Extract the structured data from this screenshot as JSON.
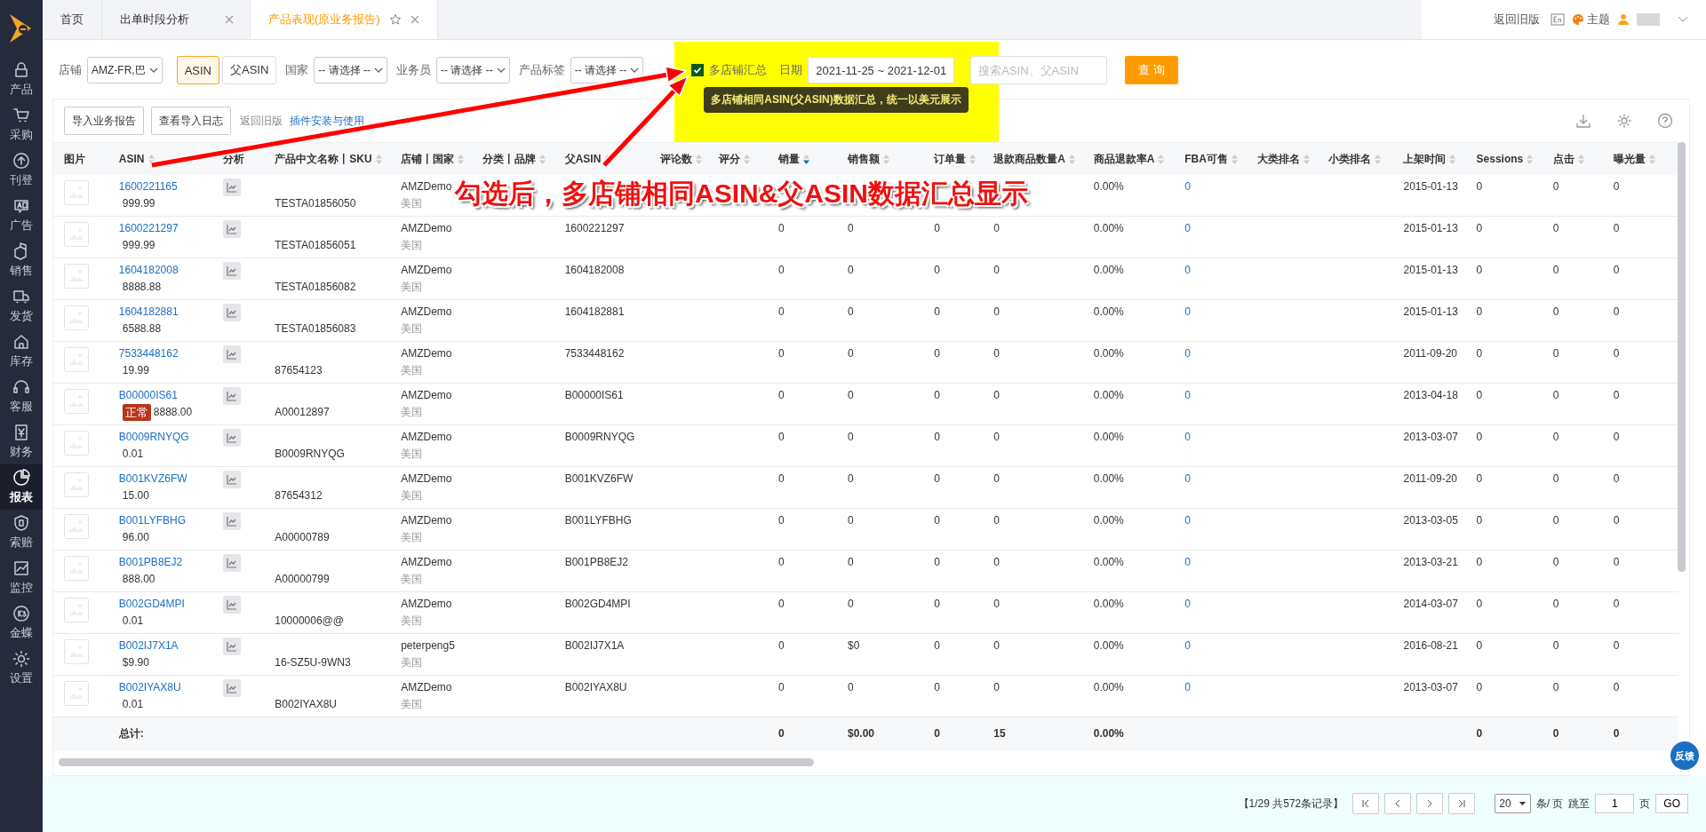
{
  "sidebar": {
    "items": [
      {
        "label": "产品",
        "selected": false
      },
      {
        "label": "采购",
        "selected": false
      },
      {
        "label": "刊登",
        "selected": false
      },
      {
        "label": "广告",
        "selected": false
      },
      {
        "label": "销售",
        "selected": false
      },
      {
        "label": "发货",
        "selected": false
      },
      {
        "label": "库存",
        "selected": false
      },
      {
        "label": "客服",
        "selected": false
      },
      {
        "label": "财务",
        "selected": false
      },
      {
        "label": "报表",
        "selected": true
      },
      {
        "label": "索赔",
        "selected": false
      },
      {
        "label": "监控",
        "selected": false
      },
      {
        "label": "金蝶",
        "selected": false
      },
      {
        "label": "设置",
        "selected": false
      }
    ]
  },
  "tabs": [
    {
      "label": "首页",
      "selected": false,
      "closable": false,
      "starred": false
    },
    {
      "label": "出单时段分析",
      "selected": false,
      "closable": true,
      "starred": false
    },
    {
      "label": "产品表现(原业务报告)",
      "selected": true,
      "closable": true,
      "starred": true
    }
  ],
  "header": {
    "back_link": "返回旧版",
    "theme": "主题"
  },
  "filters": {
    "store_label": "店铺",
    "store_value": "AMZ-FR,巴",
    "mode_toggle": [
      {
        "label": "ASIN",
        "selected": true
      },
      {
        "label": "父ASIN",
        "selected": false
      }
    ],
    "country_label": "国家",
    "country_value": "-- 请选择 --",
    "salesperson_label": "业务员",
    "salesperson_value": "-- 请选择 --",
    "tag_label": "产品标签",
    "tag_value": "-- 请选择 --",
    "multi_store": {
      "label": "多店铺汇总",
      "checked": true
    },
    "date_label": "日期",
    "date_value": "2021-11-25 ~ 2021-12-01",
    "search_placeholder": "搜索ASIN、父ASIN",
    "query_button": "查 询",
    "tooltip": "多店铺相同ASIN(父ASIN)数据汇总，统一以美元展示"
  },
  "annotation": "勾选后，多店铺相同ASIN&父ASIN数据汇总显示",
  "toolbar": {
    "buttons": [
      "导入业务报告",
      "查看导入日志"
    ],
    "back_link": "返回旧版",
    "help_link": "插件安装与使用"
  },
  "table": {
    "columns": [
      {
        "label": "图片",
        "sortable": false
      },
      {
        "label": "ASIN",
        "sortable": true,
        "sorted_desc": false
      },
      {
        "label": "分析",
        "sortable": false
      },
      {
        "label": "产品中文名称丨SKU",
        "sortable": true,
        "sorted_desc": false
      },
      {
        "label": "店铺丨国家",
        "sortable": true,
        "sorted_desc": false
      },
      {
        "label": "分类丨品牌",
        "sortable": true,
        "sorted_desc": false
      },
      {
        "label": "父ASIN",
        "sortable": true,
        "sorted_desc": false
      },
      {
        "label": "评论数",
        "sortable": true,
        "sorted_desc": false
      },
      {
        "label": "评分",
        "sortable": true,
        "sorted_desc": false
      },
      {
        "label": "销量",
        "sortable": true,
        "sorted_desc": true
      },
      {
        "label": "销售额",
        "sortable": true,
        "sorted_desc": false
      },
      {
        "label": "订单量",
        "sortable": true,
        "sorted_desc": false
      },
      {
        "label": "退款商品数量A",
        "sortable": true,
        "sorted_desc": false
      },
      {
        "label": "商品退款率A",
        "sortable": true,
        "sorted_desc": false
      },
      {
        "label": "FBA可售",
        "sortable": true,
        "sorted_desc": false
      },
      {
        "label": "大类排名",
        "sortable": true,
        "sorted_desc": false
      },
      {
        "label": "小类排名",
        "sortable": true,
        "sorted_desc": false
      },
      {
        "label": "上架时间",
        "sortable": true,
        "sorted_desc": false
      },
      {
        "label": "Sessions",
        "sortable": true,
        "sorted_desc": false
      },
      {
        "label": "点击",
        "sortable": true,
        "sorted_desc": false
      },
      {
        "label": "曝光量",
        "sortable": true,
        "sorted_desc": false
      }
    ],
    "rows": [
      {
        "asin": "1600221165",
        "price": "999.99",
        "sku": "TESTA01856050",
        "store": "AMZDemo",
        "country": "美国",
        "refund_rate": "0.00%",
        "fba": "0",
        "listed": "2015-01-13",
        "sessions": "0",
        "clicks": "0",
        "impressions": "0"
      },
      {
        "asin": "1600221297",
        "price": "999.99",
        "sku": "TESTA01856051",
        "store": "AMZDemo",
        "country": "美国",
        "parent": "1600221297",
        "qty": "0",
        "amount": "0",
        "orders": "0",
        "refund_qty": "0",
        "refund_rate": "0.00%",
        "fba": "0",
        "listed": "2015-01-13",
        "sessions": "0",
        "clicks": "0",
        "impressions": "0"
      },
      {
        "asin": "1604182008",
        "price": "8888.88",
        "sku": "TESTA01856082",
        "store": "AMZDemo",
        "country": "美国",
        "parent": "1604182008",
        "qty": "0",
        "amount": "0",
        "orders": "0",
        "refund_qty": "0",
        "refund_rate": "0.00%",
        "fba": "0",
        "listed": "2015-01-13",
        "sessions": "0",
        "clicks": "0",
        "impressions": "0"
      },
      {
        "asin": "1604182881",
        "price": "6588.88",
        "sku": "TESTA01856083",
        "store": "AMZDemo",
        "country": "美国",
        "parent": "1604182881",
        "qty": "0",
        "amount": "0",
        "orders": "0",
        "refund_qty": "0",
        "refund_rate": "0.00%",
        "fba": "0",
        "listed": "2015-01-13",
        "sessions": "0",
        "clicks": "0",
        "impressions": "0"
      },
      {
        "asin": "7533448162",
        "price": "19.99",
        "sku": "87654123",
        "store": "AMZDemo",
        "country": "美国",
        "parent": "7533448162",
        "qty": "0",
        "amount": "0",
        "orders": "0",
        "refund_qty": "0",
        "refund_rate": "0.00%",
        "fba": "0",
        "listed": "2011-09-20",
        "sessions": "0",
        "clicks": "0",
        "impressions": "0"
      },
      {
        "asin": "B00000IS61",
        "status": "正常",
        "price": "8888.00",
        "sku": "A00012897",
        "store": "AMZDemo",
        "country": "美国",
        "parent": "B00000IS61",
        "qty": "0",
        "amount": "0",
        "orders": "0",
        "refund_qty": "0",
        "refund_rate": "0.00%",
        "fba": "0",
        "listed": "2013-04-18",
        "sessions": "0",
        "clicks": "0",
        "impressions": "0"
      },
      {
        "asin": "B0009RNYQG",
        "price": "0.01",
        "sku": "B0009RNYQG",
        "store": "AMZDemo",
        "country": "美国",
        "parent": "B0009RNYQG",
        "qty": "0",
        "amount": "0",
        "orders": "0",
        "refund_qty": "0",
        "refund_rate": "0.00%",
        "fba": "0",
        "listed": "2013-03-07",
        "sessions": "0",
        "clicks": "0",
        "impressions": "0"
      },
      {
        "asin": "B001KVZ6FW",
        "price": "15.00",
        "sku": "87654312",
        "store": "AMZDemo",
        "country": "美国",
        "parent": "B001KVZ6FW",
        "qty": "0",
        "amount": "0",
        "orders": "0",
        "refund_qty": "0",
        "refund_rate": "0.00%",
        "fba": "0",
        "listed": "2011-09-20",
        "sessions": "0",
        "clicks": "0",
        "impressions": "0"
      },
      {
        "asin": "B001LYFBHG",
        "price": "96.00",
        "sku": "A00000789",
        "store": "AMZDemo",
        "country": "美国",
        "parent": "B001LYFBHG",
        "qty": "0",
        "amount": "0",
        "orders": "0",
        "refund_qty": "0",
        "refund_rate": "0.00%",
        "fba": "0",
        "listed": "2013-03-05",
        "sessions": "0",
        "clicks": "0",
        "impressions": "0"
      },
      {
        "asin": "B001PB8EJ2",
        "price": "888.00",
        "sku": "A00000799",
        "store": "AMZDemo",
        "country": "美国",
        "parent": "B001PB8EJ2",
        "qty": "0",
        "amount": "0",
        "orders": "0",
        "refund_qty": "0",
        "refund_rate": "0.00%",
        "fba": "0",
        "listed": "2013-03-21",
        "sessions": "0",
        "clicks": "0",
        "impressions": "0"
      },
      {
        "asin": "B002GD4MPI",
        "price": "0.01",
        "sku": "10000006@@",
        "store": "AMZDemo",
        "country": "美国",
        "parent": "B002GD4MPI",
        "qty": "0",
        "amount": "0",
        "orders": "0",
        "refund_qty": "0",
        "refund_rate": "0.00%",
        "fba": "0",
        "listed": "2014-03-07",
        "sessions": "0",
        "clicks": "0",
        "impressions": "0"
      },
      {
        "asin": "B002IJ7X1A",
        "price": "$9.90",
        "sku": "16-SZ5U-9WN3",
        "store": "peterpeng5",
        "country": "美国",
        "parent": "B002IJ7X1A",
        "qty": "0",
        "amount": "$0",
        "orders": "0",
        "refund_qty": "0",
        "refund_rate": "0.00%",
        "fba": "0",
        "listed": "2016-08-21",
        "sessions": "0",
        "clicks": "0",
        "impressions": "0"
      },
      {
        "asin": "B002IYAX8U",
        "price": "0.01",
        "sku": "B002IYAX8U",
        "store": "AMZDemo",
        "country": "美国",
        "parent": "B002IYAX8U",
        "qty": "0",
        "amount": "0",
        "orders": "0",
        "refund_qty": "0",
        "refund_rate": "0.00%",
        "fba": "0",
        "listed": "2013-03-07",
        "sessions": "0",
        "clicks": "0",
        "impressions": "0"
      }
    ],
    "totals": {
      "label": "总计:",
      "qty": "0",
      "amount": "$0.00",
      "orders": "0",
      "refund_qty": "15",
      "refund_rate": "0.00%",
      "sessions": "0",
      "clicks": "0",
      "impressions": "0"
    }
  },
  "pagination": {
    "summary": "【1/29  共572条记录】",
    "page_size": "20",
    "page_size_unit": "条/ 页",
    "jump_label": "跳至",
    "page_value": "1",
    "page_unit": "页",
    "go": "GO"
  },
  "feedback": "反馈"
}
